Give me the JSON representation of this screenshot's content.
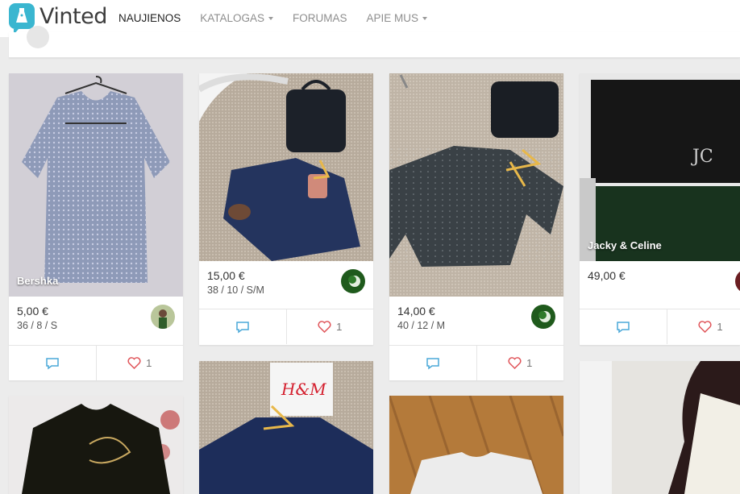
{
  "brand": {
    "name": "Vinted"
  },
  "nav": [
    {
      "label": "NAUJIENOS",
      "active": true,
      "dropdown": false
    },
    {
      "label": "KATALOGAS",
      "active": false,
      "dropdown": true
    },
    {
      "label": "FORUMAS",
      "active": false,
      "dropdown": false
    },
    {
      "label": "APIE MUS",
      "active": false,
      "dropdown": true
    }
  ],
  "items": [
    {
      "brand": "Bershka",
      "price": "5,00 €",
      "size": "36 / 8 / S",
      "likes": "1"
    },
    {
      "brand": "",
      "price": "15,00 €",
      "size": "38 / 10 / S/M",
      "likes": "1"
    },
    {
      "brand": "",
      "price": "14,00 €",
      "size": "40 / 12 / M",
      "likes": "1"
    },
    {
      "brand": "Jacky & Celine",
      "price": "49,00 €",
      "size": "",
      "likes": "1"
    }
  ],
  "icons": {
    "comment": "comment-icon",
    "like": "heart-icon"
  },
  "colors": {
    "accent": "#3ab6d0",
    "heart": "#e0555a",
    "comment": "#4aa8d8"
  }
}
